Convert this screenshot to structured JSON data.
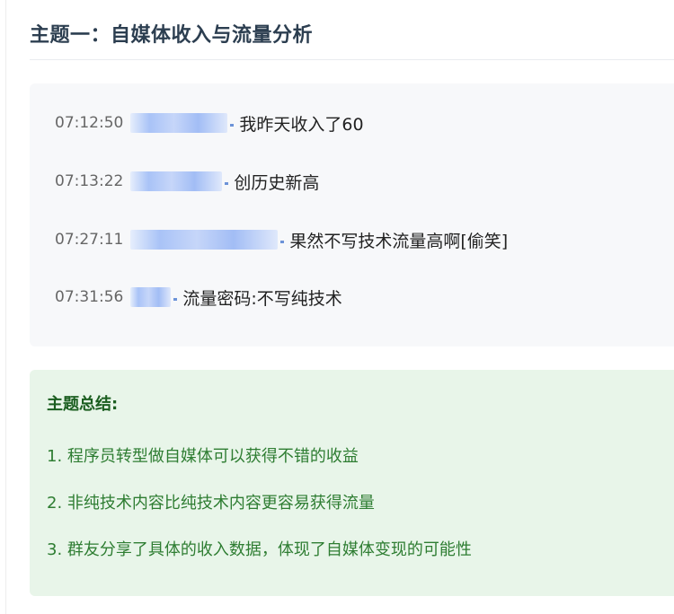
{
  "topic": {
    "title": "主题一：自媒体收入与流量分析"
  },
  "chat": {
    "messages": [
      {
        "time": "07:12:50",
        "text": "我昨天收入了60"
      },
      {
        "time": "07:13:22",
        "text": "创历史新高"
      },
      {
        "time": "07:27:11",
        "text": "果然不写技术流量高啊[偷笑]"
      },
      {
        "time": "07:31:56",
        "text": "流量密码:不写纯技术"
      }
    ]
  },
  "summary": {
    "title": "主题总结:",
    "items": [
      "1. 程序员转型做自媒体可以获得不错的收益",
      "2. 非纯技术内容比纯技术内容更容易获得流量",
      "3. 群友分享了具体的收入数据，体现了自媒体变现的可能性"
    ]
  },
  "colors": {
    "title": "#2c3e50",
    "chat_background": "#f7f8fa",
    "summary_background": "#e8f5e9",
    "summary_title": "#1b5e20",
    "summary_text": "#2e7d32"
  }
}
